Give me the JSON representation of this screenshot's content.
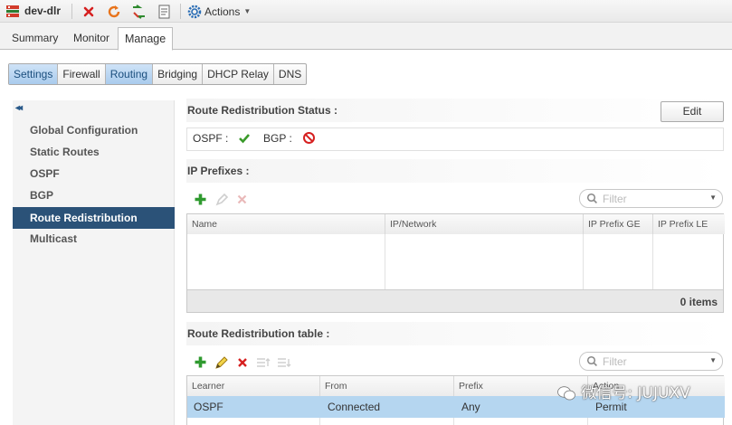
{
  "app": {
    "title": "dev-dlr",
    "actions_label": "Actions"
  },
  "tabs": [
    {
      "label": "Summary"
    },
    {
      "label": "Monitor"
    },
    {
      "label": "Manage"
    }
  ],
  "subtabs": [
    {
      "label": "Settings"
    },
    {
      "label": "Firewall"
    },
    {
      "label": "Routing"
    },
    {
      "label": "Bridging"
    },
    {
      "label": "DHCP Relay"
    },
    {
      "label": "DNS"
    }
  ],
  "sidebar": {
    "collapse_glyph": "◂◂",
    "items": [
      {
        "label": "Global Configuration"
      },
      {
        "label": "Static Routes"
      },
      {
        "label": "OSPF"
      },
      {
        "label": "BGP"
      },
      {
        "label": "Route Redistribution"
      },
      {
        "label": "Multicast"
      }
    ]
  },
  "status_section": {
    "title": "Route Redistribution Status :",
    "edit_label": "Edit",
    "ospf_label": "OSPF :",
    "bgp_label": "BGP :",
    "ospf_icon": "check-icon",
    "bgp_icon": "disabled-icon"
  },
  "prefixes_section": {
    "title": "IP Prefixes :",
    "filter_placeholder": "Filter",
    "columns": [
      "Name",
      "IP/Network",
      "IP Prefix GE",
      "IP Prefix LE"
    ],
    "count_label": "0 items"
  },
  "redist_section": {
    "title": "Route Redistribution table :",
    "filter_placeholder": "Filter",
    "columns": [
      "Learner",
      "From",
      "Prefix",
      "Action"
    ],
    "rows": [
      {
        "learner": "OSPF",
        "from": "Connected",
        "prefix": "Any",
        "action": "Permit"
      }
    ]
  },
  "watermark": "微信号: JUJUXV",
  "colors": {
    "accent_selected": "#2b5278",
    "selected_row": "#b5d6f0",
    "subtab_selected": "#a9cbed"
  }
}
